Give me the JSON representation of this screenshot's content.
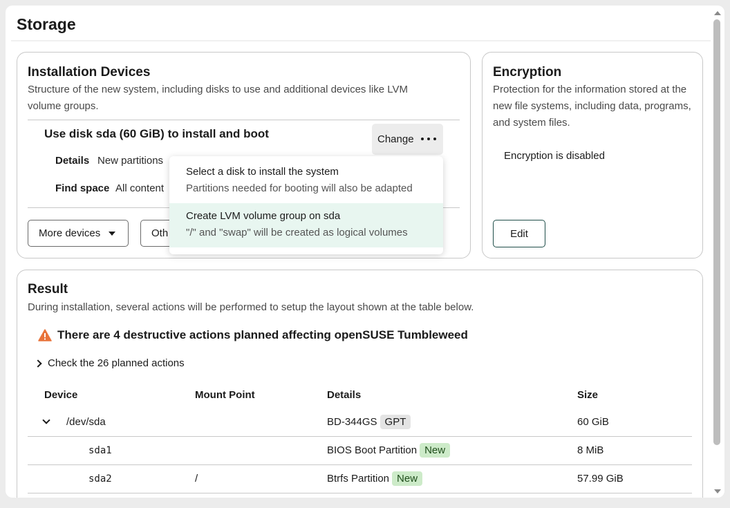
{
  "page": {
    "title": "Storage"
  },
  "installation_devices": {
    "title": "Installation Devices",
    "description": "Structure of the new system, including disks to use and additional devices like LVM volume groups.",
    "selection_title": "Use disk sda (60 GiB) to install and boot",
    "details_label": "Details",
    "details_value": "New partitions",
    "find_space_label": "Find space",
    "find_space_value": "All content",
    "change_label": "Change",
    "more_devices_label": "More devices",
    "other_label": "Oth"
  },
  "change_menu": {
    "items": [
      {
        "title": "Select a disk to install the system",
        "description": "Partitions needed for booting will also be adapted"
      },
      {
        "title": "Create LVM volume group on sda",
        "description": "\"/\" and \"swap\" will be created as logical volumes"
      }
    ]
  },
  "encryption": {
    "title": "Encryption",
    "description": "Protection for the information stored at the new file systems, including data, programs, and system files.",
    "status": "Encryption is disabled",
    "edit_label": "Edit"
  },
  "result": {
    "title": "Result",
    "description": "During installation, several actions will be performed to setup the layout shown at the table below.",
    "warning": "There are 4 destructive actions planned affecting openSUSE Tumbleweed",
    "actions_toggle": "Check the 26 planned actions",
    "columns": [
      "Device",
      "Mount Point",
      "Details",
      "Size"
    ],
    "rows": [
      {
        "device": "/dev/sda",
        "mount": "",
        "details": "BD-344GS",
        "badge": "GPT",
        "size": "60 GiB"
      },
      {
        "device": "sda1",
        "mount": "",
        "details": "BIOS Boot Partition",
        "badge": "New",
        "size": "8 MiB"
      },
      {
        "device": "sda2",
        "mount": "/",
        "details": "Btrfs Partition",
        "badge": "New",
        "size": "57.99 GiB"
      }
    ]
  },
  "colors": {
    "accent": "#1e4d48",
    "highlight": "#e8f6f0",
    "new_badge": "#cdebc9",
    "warning": "#e8743b"
  }
}
